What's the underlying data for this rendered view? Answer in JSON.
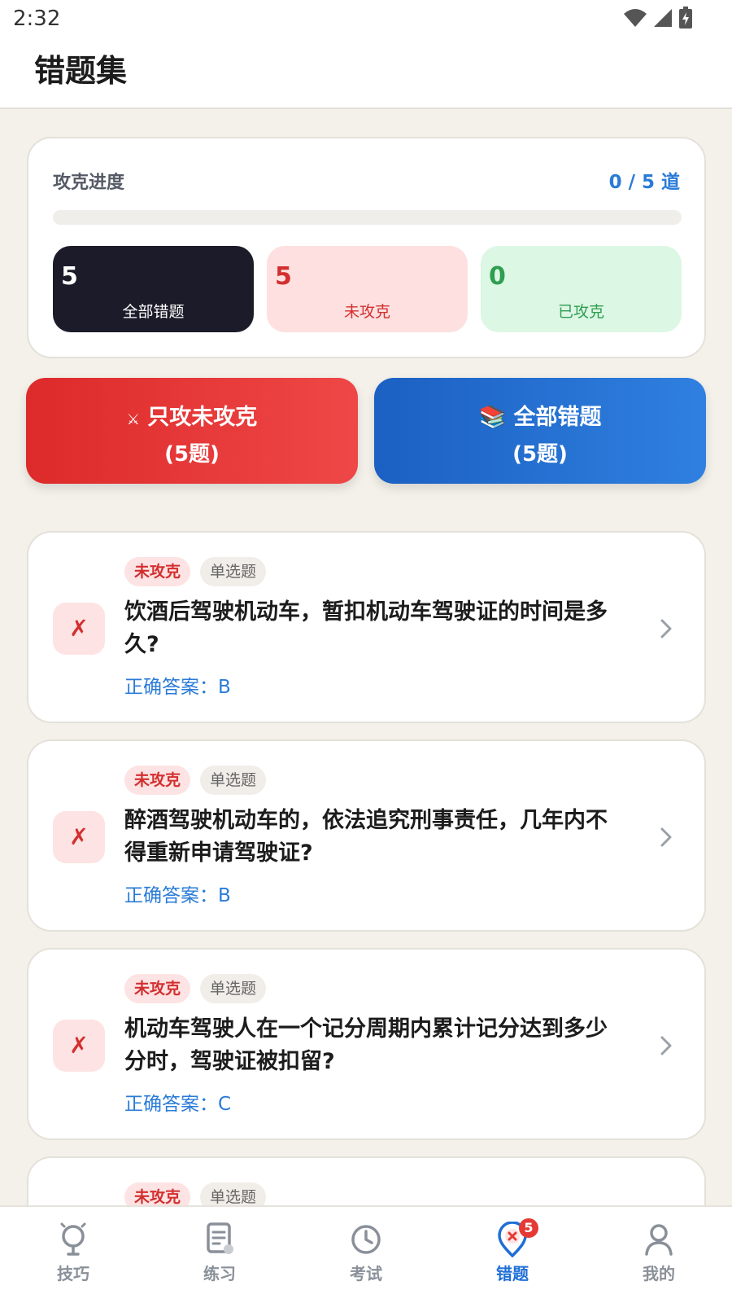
{
  "status_bar": {
    "time": "2:32"
  },
  "header": {
    "title": "错题集"
  },
  "progress": {
    "label": "攻克进度",
    "count_text": "0 / 5 道",
    "conquered": 0,
    "total": 5,
    "fraction": 0,
    "stats": [
      {
        "value": "5",
        "label": "全部错题"
      },
      {
        "value": "5",
        "label": "未攻克"
      },
      {
        "value": "0",
        "label": "已攻克"
      }
    ]
  },
  "actions": {
    "attack_unconquered": {
      "icon": "⚔",
      "label": "只攻未攻克",
      "count": "(5题)"
    },
    "all_mistakes": {
      "icon": "📚",
      "label": "全部错题",
      "count": "(5题)"
    }
  },
  "questions": [
    {
      "status": "未攻克",
      "type": "单选题",
      "text": "饮酒后驾驶机动车，暂扣机动车驾驶证的时间是多久?",
      "answer": "正确答案：B",
      "mark": "✗"
    },
    {
      "status": "未攻克",
      "type": "单选题",
      "text": "醉酒驾驶机动车的，依法追究刑事责任，几年内不得重新申请驾驶证?",
      "answer": "正确答案：B",
      "mark": "✗"
    },
    {
      "status": "未攻克",
      "type": "单选题",
      "text": "机动车驾驶人在一个记分周期内累计记分达到多少分时，驾驶证被扣留?",
      "answer": "正确答案：C",
      "mark": "✗"
    },
    {
      "status": "未攻克",
      "type": "单选题",
      "text": "",
      "answer": "",
      "mark": "✗"
    }
  ],
  "tabbar": {
    "tabs": [
      {
        "label": "技巧",
        "icon": "lightbulb-icon"
      },
      {
        "label": "练习",
        "icon": "document-icon"
      },
      {
        "label": "考试",
        "icon": "clock-icon"
      },
      {
        "label": "错题",
        "icon": "error-pin-icon",
        "badge": "5",
        "active": true
      },
      {
        "label": "我的",
        "icon": "user-icon"
      }
    ]
  },
  "colors": {
    "accent_blue": "#2a7bd8",
    "danger_red": "#d32f2f",
    "success_green": "#2e9e50",
    "dark": "#1c1b29"
  }
}
